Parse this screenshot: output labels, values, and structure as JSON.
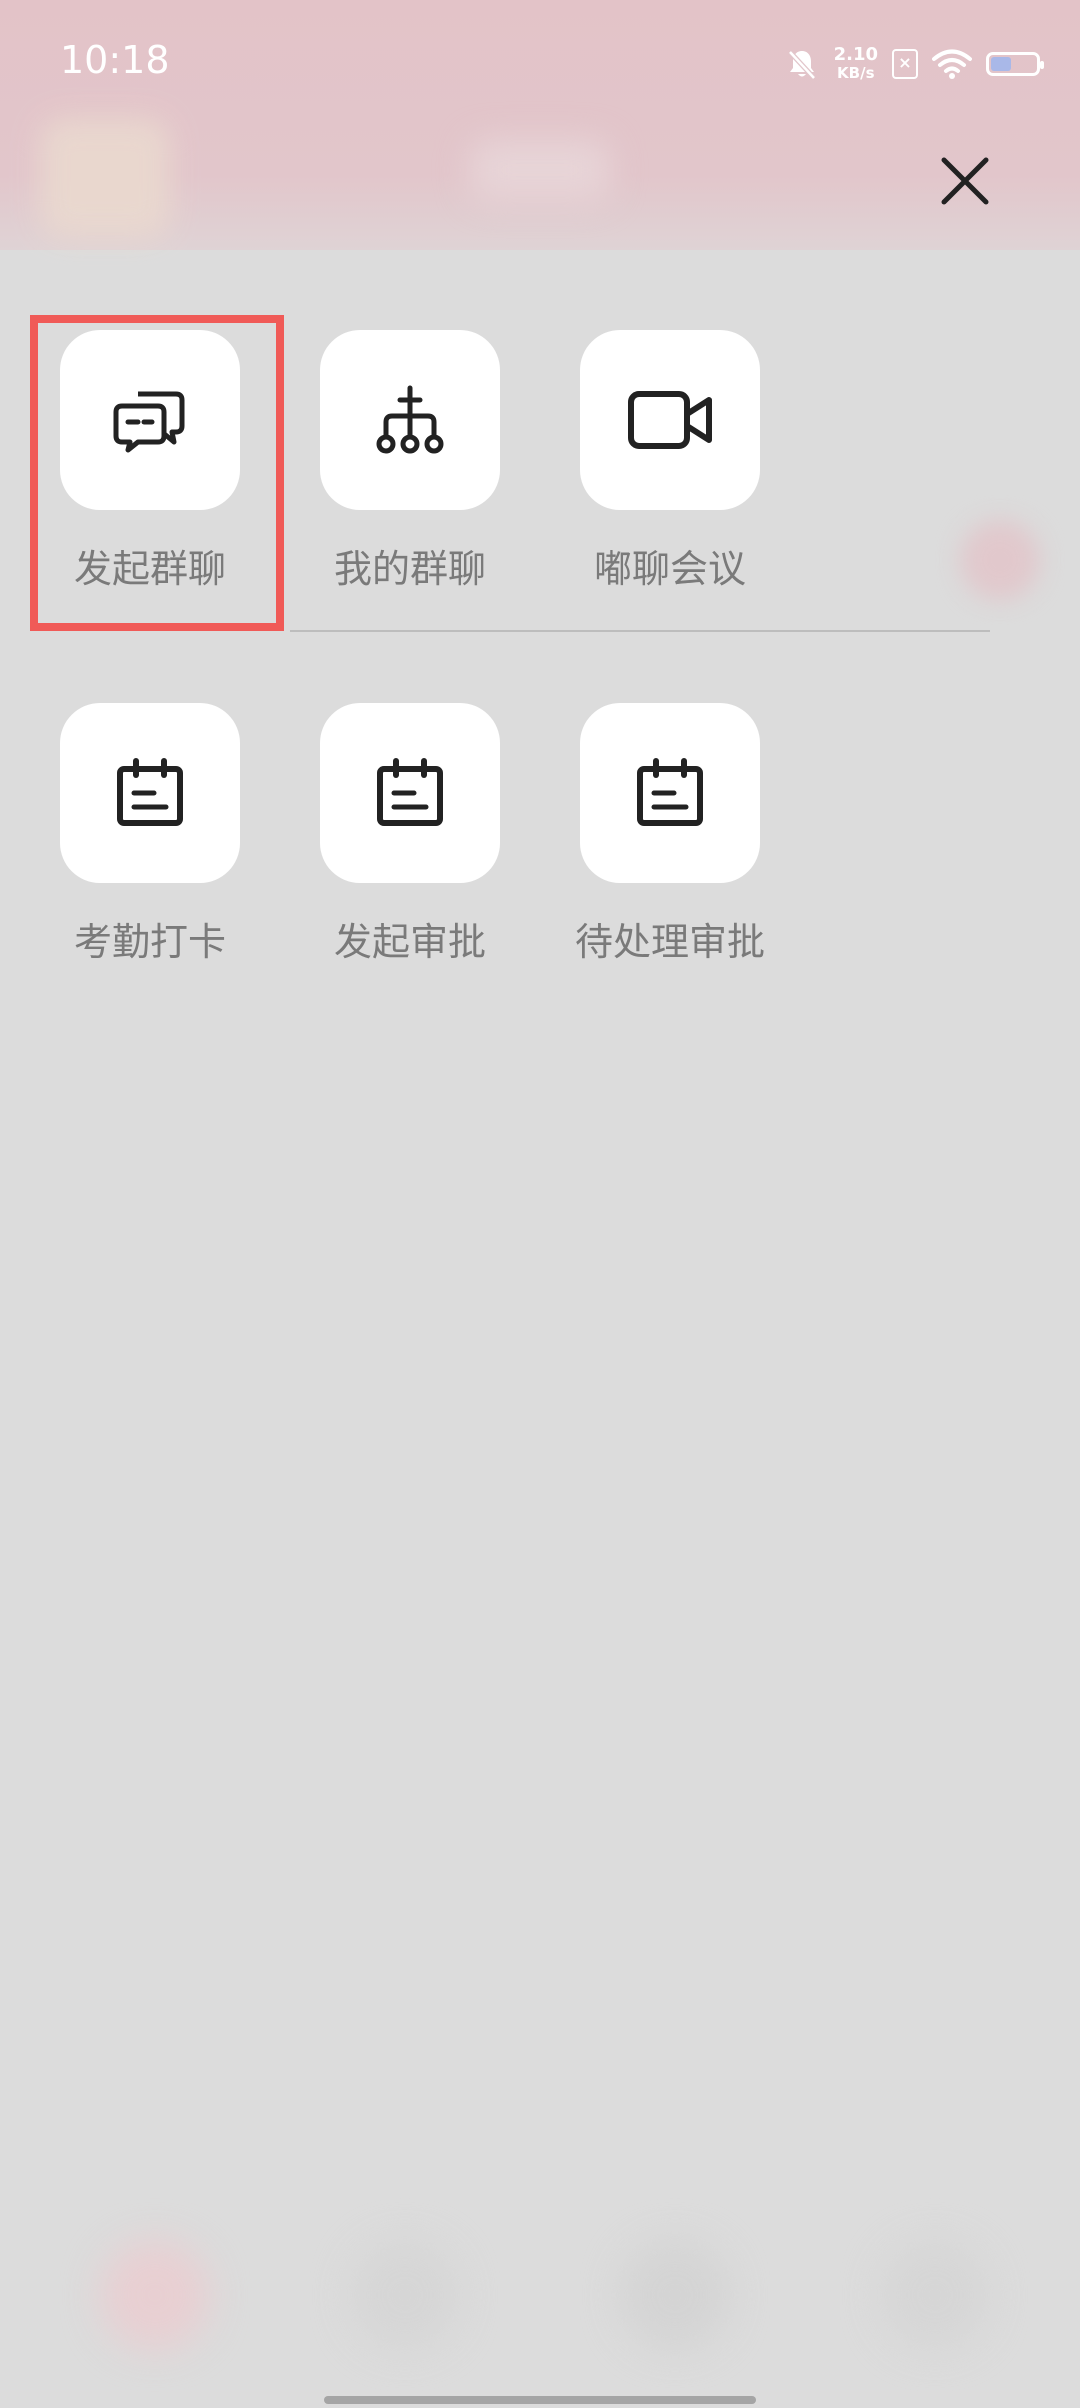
{
  "status_bar": {
    "time": "10:18",
    "net_speed_value": "2.10",
    "net_speed_unit": "KB/s",
    "sim_label": "×",
    "battery_level": 0.45
  },
  "menu": {
    "row1": [
      {
        "label": "发起群聊",
        "icon": "chat-bubbles-icon"
      },
      {
        "label": "我的群聊",
        "icon": "org-tree-icon"
      },
      {
        "label": "嘟聊会议",
        "icon": "video-camera-icon"
      }
    ],
    "row2": [
      {
        "label": "考勤打卡",
        "icon": "calendar-note-icon"
      },
      {
        "label": "发起审批",
        "icon": "calendar-note-icon"
      },
      {
        "label": "待处理审批",
        "icon": "calendar-note-icon"
      }
    ]
  },
  "colors": {
    "highlight": "#f05a57",
    "overlay": "#dcdcdc",
    "header_tint": "#e3c3c8",
    "label_text": "#7a7a7a"
  }
}
